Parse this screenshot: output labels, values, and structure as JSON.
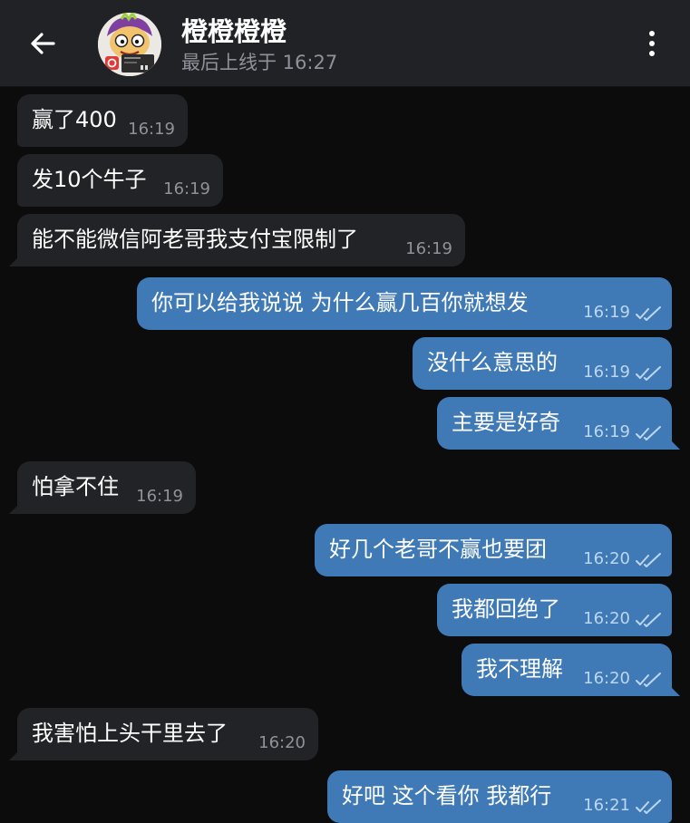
{
  "header": {
    "contact_name": "橙橙橙橙",
    "last_seen": "最后上线于 16:27",
    "back_icon": "arrow-left-icon",
    "menu_icon": "more-vertical-icon"
  },
  "colors": {
    "header_bg": "#212226",
    "chat_bg": "#0c0c0d",
    "incoming_bubble": "#222327",
    "outgoing_bubble": "#3f7ab6"
  },
  "messages": [
    {
      "direction": "incoming",
      "text": "赢了400",
      "time": "16:19"
    },
    {
      "direction": "incoming",
      "text": "发10个牛子",
      "time": "16:19"
    },
    {
      "direction": "incoming",
      "text": "能不能微信阿老哥我支付宝限制了",
      "time": "16:19"
    },
    {
      "direction": "outgoing",
      "text": "你可以给我说说 为什么赢几百你就想发",
      "time": "16:19",
      "status": "read"
    },
    {
      "direction": "outgoing",
      "text": "没什么意思的",
      "time": "16:19",
      "status": "read"
    },
    {
      "direction": "outgoing",
      "text": "主要是好奇",
      "time": "16:19",
      "status": "read"
    },
    {
      "direction": "incoming",
      "text": "怕拿不住",
      "time": "16:19"
    },
    {
      "direction": "outgoing",
      "text": "好几个老哥不赢也要团",
      "time": "16:20",
      "status": "read"
    },
    {
      "direction": "outgoing",
      "text": "我都回绝了",
      "time": "16:20",
      "status": "read"
    },
    {
      "direction": "outgoing",
      "text": "我不理解",
      "time": "16:20",
      "status": "read"
    },
    {
      "direction": "incoming",
      "text": "我害怕上头干里去了",
      "time": "16:20"
    },
    {
      "direction": "outgoing",
      "text": "好吧 这个看你 我都行",
      "time": "16:21",
      "status": "read"
    }
  ]
}
